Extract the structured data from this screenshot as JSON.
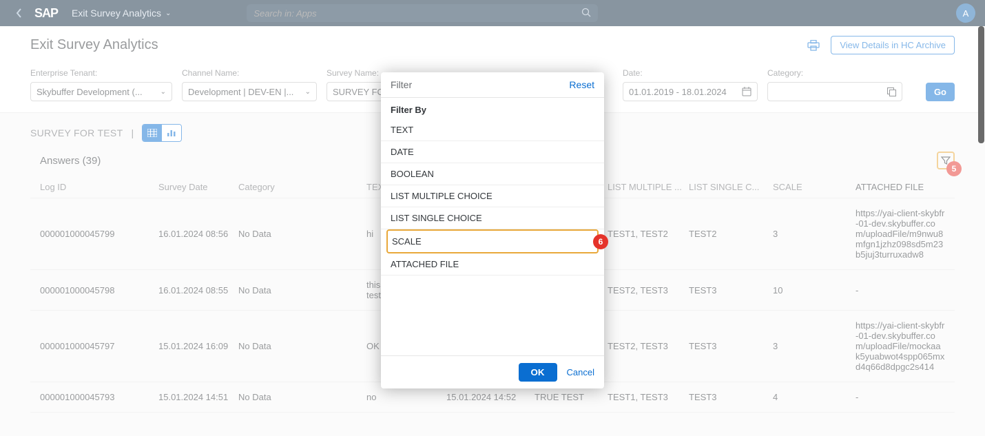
{
  "header": {
    "app_title": "Exit Survey Analytics",
    "search_placeholder": "Search in: Apps",
    "avatar_initial": "A"
  },
  "page": {
    "title": "Exit Survey Analytics",
    "view_details_btn": "View Details in HC Archive"
  },
  "filterbar": {
    "tenant_label": "Enterprise Tenant:",
    "tenant_value": "Skybuffer Development (...",
    "channel_label": "Channel Name:",
    "channel_value": "Development | DEV-EN |...",
    "survey_label": "Survey Name:",
    "survey_value": "SURVEY FOR",
    "date_label": "Date:",
    "date_value": "01.01.2019 - 18.01.2024",
    "category_label": "Category:",
    "category_value": "",
    "go_label": "Go"
  },
  "survey_section": {
    "title": "SURVEY FOR TEST",
    "title_sep": "|",
    "answers_title": "Answers (39)",
    "filter_badge": "5"
  },
  "columns": {
    "logid": "Log ID",
    "surveydate": "Survey Date",
    "category": "Category",
    "text": "TEX",
    "date": "",
    "bool": "",
    "listm": "LIST MULTIPLE ...",
    "lists": "LIST SINGLE C...",
    "scale": "SCALE",
    "file": "ATTACHED FILE"
  },
  "rows": [
    {
      "logid": "000001000045799",
      "surveydate": "16.01.2024 08:56",
      "category": "No Data",
      "text": "hi",
      "date": "",
      "bool": "",
      "listm": "TEST1, TEST2",
      "lists": "TEST2",
      "scale": "3",
      "file": "https://yai-client-skybfr-01-dev.skybuffer.com/uploadFile/m9nwu8mfgn1jzhz098sd5m23b5juj3turruxadw8"
    },
    {
      "logid": "000001000045798",
      "surveydate": "16.01.2024 08:55",
      "category": "No Data",
      "text": "this\ntest",
      "date": "",
      "bool": "",
      "listm": "TEST2, TEST3",
      "lists": "TEST3",
      "scale": "10",
      "file": "-"
    },
    {
      "logid": "000001000045797",
      "surveydate": "15.01.2024 16:09",
      "category": "No Data",
      "text": "OK",
      "date": "",
      "bool": "",
      "listm": "TEST2, TEST3",
      "lists": "TEST3",
      "scale": "3",
      "file": "https://yai-client-skybfr-01-dev.skybuffer.com/uploadFile/mockaak5yuabwot4spp065mxd4q66d8dpgc2s414"
    },
    {
      "logid": "000001000045793",
      "surveydate": "15.01.2024 14:51",
      "category": "No Data",
      "text": "no",
      "date": "15.01.2024 14:52",
      "bool": "TRUE TEST",
      "listm": "TEST1, TEST3",
      "lists": "TEST3",
      "scale": "4",
      "file": "-"
    }
  ],
  "dialog": {
    "title": "Filter",
    "reset": "Reset",
    "filter_by": "Filter By",
    "items": [
      "TEXT",
      "DATE",
      "BOOLEAN",
      "LIST MULTIPLE CHOICE",
      "LIST SINGLE CHOICE",
      "SCALE",
      "ATTACHED FILE"
    ],
    "selected_index": 5,
    "selected_badge": "6",
    "ok": "OK",
    "cancel": "Cancel"
  }
}
